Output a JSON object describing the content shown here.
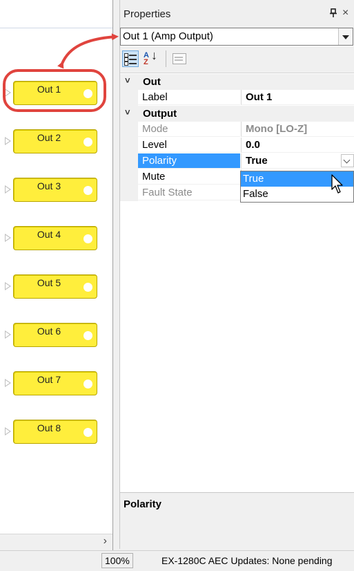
{
  "canvas": {
    "outputs": [
      {
        "label": "Out 1",
        "top": 0
      },
      {
        "label": "Out 2",
        "top": 0
      },
      {
        "label": "Out 3",
        "top": 0
      },
      {
        "label": "Out 4",
        "top": 0
      },
      {
        "label": "Out 5",
        "top": 0
      },
      {
        "label": "Out 6",
        "top": 0
      },
      {
        "label": "Out 7",
        "top": 0
      },
      {
        "label": "Out 8",
        "top": 0
      }
    ],
    "scroll_right_glyph": "›"
  },
  "properties": {
    "title": "Properties",
    "pin_glyph": "ⵐ",
    "close_glyph": "×",
    "selected_object": "Out 1 (Amp Output)",
    "categories": [
      {
        "name": "Out",
        "rows": [
          {
            "name": "Label",
            "value": "Out 1",
            "disabled": false
          }
        ]
      },
      {
        "name": "Output",
        "rows": [
          {
            "name": "Mode",
            "value": "Mono [LO-Z]",
            "disabled": true
          },
          {
            "name": "Level",
            "value": "0.0",
            "disabled": false
          },
          {
            "name": "Polarity",
            "value": "True",
            "disabled": false,
            "selected": true
          },
          {
            "name": "Mute",
            "value": "",
            "disabled": false
          },
          {
            "name": "Fault State",
            "value": "",
            "disabled": true
          }
        ]
      }
    ],
    "dropdown_options": [
      "True",
      "False"
    ],
    "dropdown_highlighted": "True",
    "description_title": "Polarity"
  },
  "status": {
    "zoom": "100%",
    "text": "EX-1280C AEC Updates: None pending"
  },
  "colors": {
    "block_fill": "#ffee3c",
    "selection_blue": "#3399ff",
    "annotation_red": "#e0443e"
  }
}
